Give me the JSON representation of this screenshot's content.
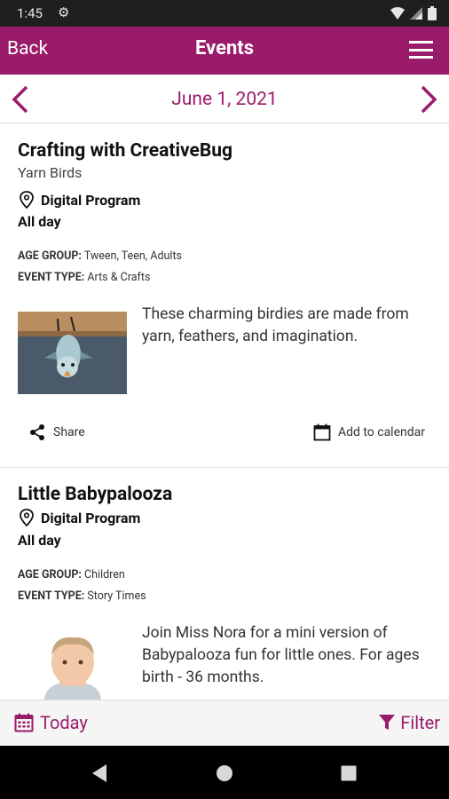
{
  "status": {
    "time": "1:45"
  },
  "appbar": {
    "back_label": "Back",
    "title": "Events"
  },
  "datebar": {
    "date": "June 1, 2021"
  },
  "events": [
    {
      "title": "Crafting with CreativeBug",
      "subtitle": "Yarn Birds",
      "location": "Digital Program",
      "time": "All day",
      "age_group_label": "AGE GROUP:",
      "age_group": "Tween, Teen, Adults",
      "event_type_label": "EVENT TYPE:",
      "event_type": "Arts & Crafts",
      "description": "These charming birdies are made from yarn, feathers, and imagination.",
      "share_label": "Share",
      "calendar_label": "Add to calendar"
    },
    {
      "title": "Little Babypalooza",
      "location": "Digital Program",
      "time": "All day",
      "age_group_label": "AGE GROUP:",
      "age_group": "Children",
      "event_type_label": "EVENT TYPE:",
      "event_type": "Story Times",
      "description": "Join Miss Nora for a mini version of Babypalooza fun for little ones. For ages birth - 36 months."
    }
  ],
  "bottombar": {
    "today_label": "Today",
    "filter_label": "Filter"
  },
  "colors": {
    "accent": "#9b1b6b"
  }
}
